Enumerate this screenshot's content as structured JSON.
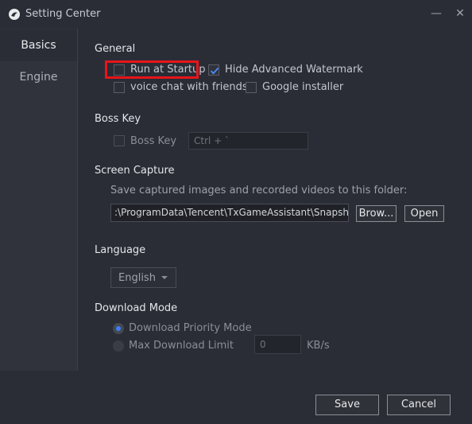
{
  "window": {
    "title": "Setting Center",
    "minimize_glyph": "—",
    "close_glyph": "✕"
  },
  "sidebar": {
    "items": [
      {
        "label": "Basics",
        "active": true
      },
      {
        "label": "Engine",
        "active": false
      }
    ]
  },
  "general": {
    "title": "General",
    "run_at_startup": {
      "label": "Run at Startup",
      "checked": false
    },
    "hide_watermark": {
      "label": "Hide Advanced Watermark",
      "checked": true
    },
    "voice_chat": {
      "label": "voice chat with friends",
      "checked": false
    },
    "google_installer": {
      "label": "Google installer",
      "checked": false
    }
  },
  "boss_key": {
    "title": "Boss Key",
    "checkbox_label": "Boss Key",
    "checked": false,
    "shortcut_value": "Ctrl + `"
  },
  "screen_capture": {
    "title": "Screen Capture",
    "description": "Save captured images and recorded videos to this folder:",
    "path": ":\\ProgramData\\Tencent\\TxGameAssistant\\Snapshot",
    "browse_label": "Brow...",
    "open_label": "Open"
  },
  "language": {
    "title": "Language",
    "selected": "English"
  },
  "download_mode": {
    "title": "Download Mode",
    "priority_label": "Download Priority Mode",
    "max_limit_label": "Max Download Limit",
    "selected": "priority",
    "limit_value": "0",
    "unit": "KB/s"
  },
  "footer": {
    "save_label": "Save",
    "cancel_label": "Cancel"
  },
  "colors": {
    "background": "#2a2d36",
    "sidebar": "#30333c",
    "accent_blue": "#3d7ff6",
    "highlight_red": "#e8141a"
  }
}
